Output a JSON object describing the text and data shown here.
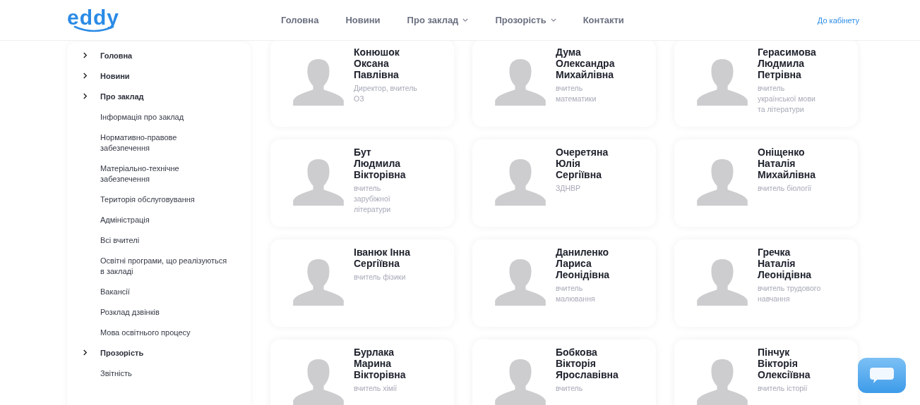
{
  "header": {
    "logo": "eddy",
    "nav": [
      {
        "label": "Головна",
        "has_dropdown": false
      },
      {
        "label": "Новини",
        "has_dropdown": false
      },
      {
        "label": "Про заклад",
        "has_dropdown": true
      },
      {
        "label": "Прозорість",
        "has_dropdown": true
      },
      {
        "label": "Контакти",
        "has_dropdown": false
      }
    ],
    "account_link": "До кабінету"
  },
  "sidebar": {
    "items": [
      {
        "label": "Головна",
        "kind": "section"
      },
      {
        "label": "Новини",
        "kind": "section"
      },
      {
        "label": "Про заклад",
        "kind": "section"
      },
      {
        "label": "Інформація про заклад",
        "kind": "link"
      },
      {
        "label": "Нормативно-правове забезпечення",
        "kind": "link"
      },
      {
        "label": "Матеріально-технічне забезпечення",
        "kind": "link"
      },
      {
        "label": "Територія обслуговування",
        "kind": "link"
      },
      {
        "label": "Адміністрація",
        "kind": "link"
      },
      {
        "label": "Всі вчителі",
        "kind": "link"
      },
      {
        "label": "Освітні програми, що реалізуються в закладі",
        "kind": "link"
      },
      {
        "label": "Вакансії",
        "kind": "link"
      },
      {
        "label": "Розклад дзвінків",
        "kind": "link"
      },
      {
        "label": "Мова освітнього процесу",
        "kind": "link"
      },
      {
        "label": "Прозорість",
        "kind": "section"
      },
      {
        "label": "Звітність",
        "kind": "link"
      }
    ]
  },
  "staff": [
    {
      "name": [
        "Конюшок",
        "Оксана",
        "Павлівна"
      ],
      "role": "Директор, вчитель ОЗ"
    },
    {
      "name": [
        "Дума",
        "Олександра",
        "Михайлівна"
      ],
      "role": "вчитель математики"
    },
    {
      "name": [
        "Герасимова",
        "Людмила",
        "Петрівна"
      ],
      "role": "вчитель української мови та літератури"
    },
    {
      "name": [
        "Бут",
        "Людмила",
        "Вікторівна"
      ],
      "role": "вчитель зарубіжної літератури"
    },
    {
      "name": [
        "Очеретяна",
        "Юлія",
        "Сергіївна"
      ],
      "role": "ЗДНВР"
    },
    {
      "name": [
        "Оніщенко",
        "Наталія",
        "Михайлівна"
      ],
      "role": "вчитель біології"
    },
    {
      "name": [
        "Іванюк Інна",
        "Сергіївна"
      ],
      "role": "вчитель фізики"
    },
    {
      "name": [
        "Даниленко",
        "Лариса",
        "Леонідівна"
      ],
      "role": "вчитель малювання"
    },
    {
      "name": [
        "Гречка",
        "Наталія",
        "Леонідівна"
      ],
      "role": "вчитель трудового навчання"
    },
    {
      "name": [
        "Бурлака",
        "Марина",
        "Вікторівна"
      ],
      "role": "вчитель хімії"
    },
    {
      "name": [
        "Бобкова",
        "Вікторія",
        "Ярославівна"
      ],
      "role": "вчитель"
    },
    {
      "name": [
        "Пінчук",
        "Вікторія",
        "Олексіївна"
      ],
      "role": "вчитель історії"
    }
  ]
}
